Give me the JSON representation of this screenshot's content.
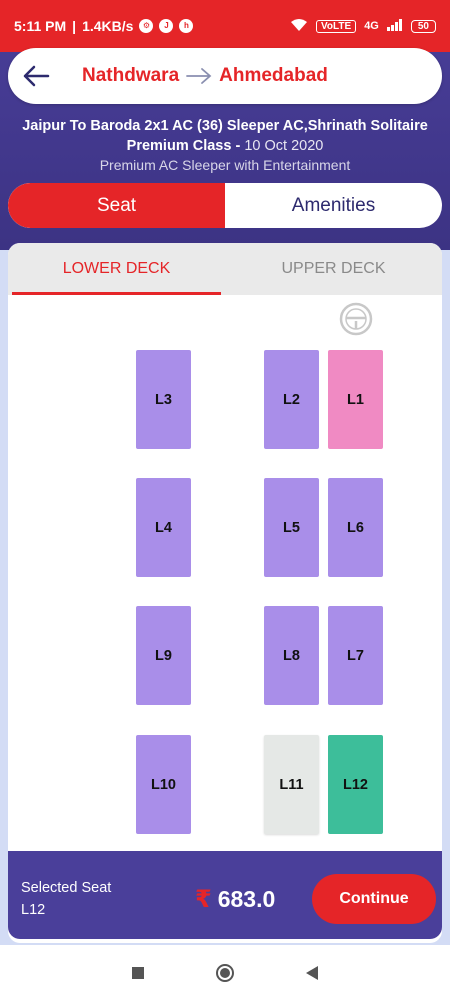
{
  "status_bar": {
    "time": "5:11 PM",
    "speed": "1.4KB/s",
    "network": "4G",
    "volte": "VoLTE",
    "battery": "50"
  },
  "route": {
    "from": "Nathdwara",
    "to": "Ahmedabad"
  },
  "bus": {
    "title_line1": "Jaipur To Baroda 2x1 AC (36) Sleeper AC,Shrinath Solitaire",
    "title_line2": "Premium Class - ",
    "date": "10 Oct 2020",
    "subtitle": "Premium AC Sleeper with Entertainment"
  },
  "toggle": {
    "seat_label": "Seat",
    "amenities_label": "Amenities"
  },
  "deck_tabs": {
    "lower": "LOWER DECK",
    "upper": "UPPER DECK"
  },
  "seats": [
    {
      "id": "L3",
      "status": "available"
    },
    {
      "id": "L2",
      "status": "available"
    },
    {
      "id": "L1",
      "status": "ladies"
    },
    {
      "id": "L4",
      "status": "available"
    },
    {
      "id": "L5",
      "status": "available"
    },
    {
      "id": "L6",
      "status": "available"
    },
    {
      "id": "L9",
      "status": "available"
    },
    {
      "id": "L8",
      "status": "available"
    },
    {
      "id": "L7",
      "status": "available"
    },
    {
      "id": "L10",
      "status": "available"
    },
    {
      "id": "L11",
      "status": "booked"
    },
    {
      "id": "L12",
      "status": "selected"
    }
  ],
  "bottom": {
    "selected_label": "Selected Seat",
    "selected_value": "L12",
    "currency": "₹",
    "price": "683.0",
    "continue_label": "Continue"
  },
  "colors": {
    "brand_red": "#e52528",
    "header_purple": "#4a3f9a",
    "seat_available": "#a98ee9",
    "seat_ladies": "#f08ac3",
    "seat_selected": "#3dbe9a",
    "seat_booked": "#e5e8e6"
  }
}
